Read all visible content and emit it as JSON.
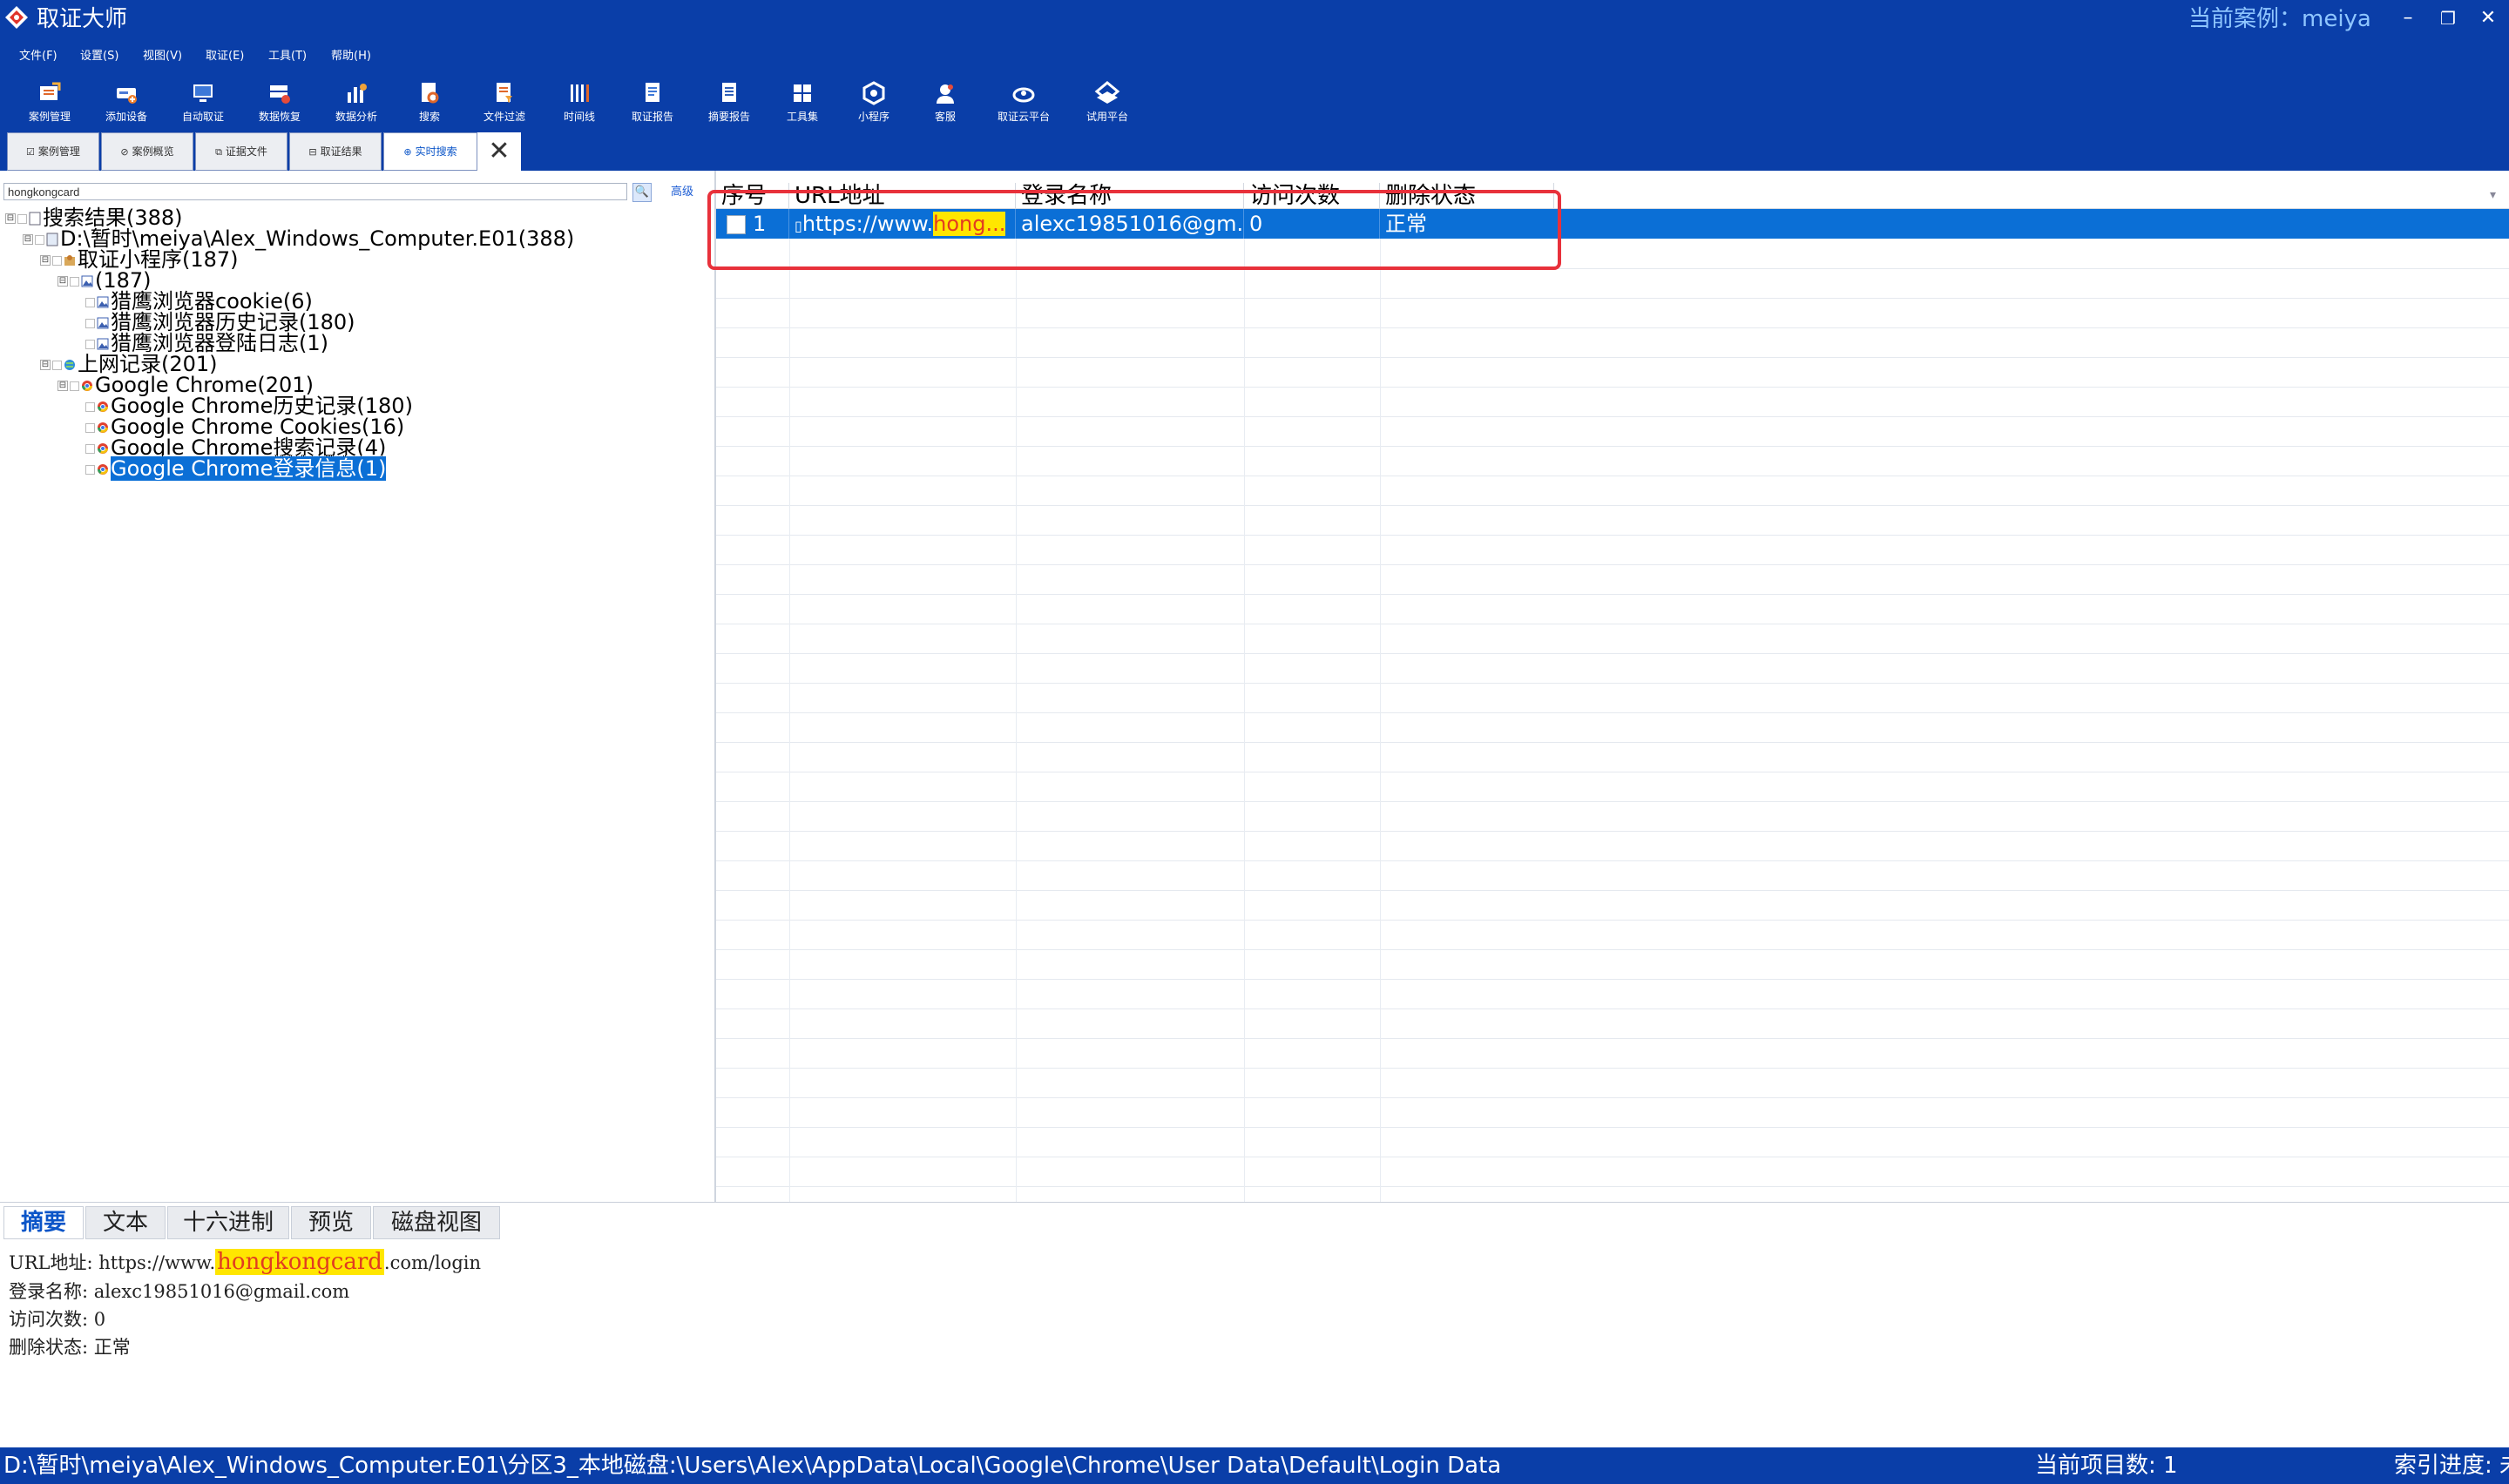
{
  "window": {
    "title": "取证大师",
    "case_label": "当前案例：meiya",
    "buttons": {
      "minimize": "–",
      "restore": "❐",
      "close": "✕"
    }
  },
  "menu": [
    "文件(F)",
    "设置(S)",
    "视图(V)",
    "取证(E)",
    "工具(T)",
    "帮助(H)"
  ],
  "toolbar": [
    {
      "label": "案例管理",
      "icon": "case-manage-icon"
    },
    {
      "label": "添加设备",
      "icon": "add-device-icon"
    },
    {
      "label": "自动取证",
      "icon": "auto-forensic-icon"
    },
    {
      "label": "数据恢复",
      "icon": "data-recovery-icon"
    },
    {
      "label": "数据分析",
      "icon": "data-analysis-icon"
    },
    {
      "label": "搜索",
      "icon": "search-doc-icon"
    },
    {
      "label": "文件过滤",
      "icon": "file-filter-icon"
    },
    {
      "label": "时间线",
      "icon": "timeline-icon"
    },
    {
      "label": "取证报告",
      "icon": "forensic-report-icon"
    },
    {
      "label": "摘要报告",
      "icon": "summary-report-icon"
    },
    {
      "label": "工具集",
      "icon": "toolset-icon"
    },
    {
      "label": "小程序",
      "icon": "applet-icon"
    },
    {
      "label": "客服",
      "icon": "support-icon"
    },
    {
      "label": "取证云平台",
      "icon": "cloud-platform-icon"
    },
    {
      "label": "试用平台",
      "icon": "trial-platform-icon"
    }
  ],
  "tabs": [
    {
      "label": "案例管理",
      "icon": "☑"
    },
    {
      "label": "案例概览",
      "icon": "⊘"
    },
    {
      "label": "证据文件",
      "icon": "⧉"
    },
    {
      "label": "取证结果",
      "icon": "⊟"
    },
    {
      "label": "实时搜索",
      "icon": "⊕",
      "active": true
    }
  ],
  "search": {
    "value": "hongkongcard",
    "button": "🔍",
    "advanced": "高级"
  },
  "tree": [
    {
      "label": "搜索结果(388)",
      "level": 0,
      "toggle": "⊟"
    },
    {
      "label": "D:\\暂时\\meiya\\Alex_Windows_Computer.E01(388)",
      "level": 1,
      "toggle": "⊟"
    },
    {
      "label": "取证小程序(187)",
      "level": 2,
      "toggle": "⊟"
    },
    {
      "label": "(187)",
      "level": 3,
      "toggle": "⊟"
    },
    {
      "label": "猎鹰浏览器cookie(6)",
      "level": 4
    },
    {
      "label": "猎鹰浏览器历史记录(180)",
      "level": 4
    },
    {
      "label": "猎鹰浏览器登陆日志(1)",
      "level": 4
    },
    {
      "label": "上网记录(201)",
      "level": 2,
      "toggle": "⊟"
    },
    {
      "label": "Google Chrome(201)",
      "level": 3,
      "toggle": "⊟"
    },
    {
      "label": "Google Chrome历史记录(180)",
      "level": 4
    },
    {
      "label": "Google Chrome Cookies(16)",
      "level": 4
    },
    {
      "label": "Google Chrome搜索记录(4)",
      "level": 4
    },
    {
      "label": "Google Chrome登录信息(1)",
      "level": 4,
      "selected": true
    }
  ],
  "grid": {
    "columns": [
      "序号",
      "URL地址",
      "登录名称",
      "访问次数",
      "删除状态"
    ],
    "rows": [
      {
        "index": "1",
        "url_prefix": "https://www.",
        "url_highlight": "hong...",
        "login": "alexc19851016@gm...",
        "visits": "0",
        "status": "正常"
      }
    ]
  },
  "bottom_tabs": [
    "摘要",
    "文本",
    "十六进制",
    "预览",
    "磁盘视图"
  ],
  "detail": {
    "url_label": "URL地址:",
    "url_prefix": " https://www.",
    "url_highlight": "hongkongcard",
    "url_suffix": ".com/login",
    "login_line": "登录名称: alexc19851016@gmail.com",
    "visits_line": "访问次数: 0",
    "status_line": "删除状态: 正常"
  },
  "status": {
    "path": "D:\\暂时\\meiya\\Alex_Windows_Computer.E01\\分区3_本地磁盘:\\Users\\Alex\\AppData\\Local\\Google\\Chrome\\User Data\\Default\\Login Data",
    "item_count": "当前项目数: 1",
    "index_progress": "索引进度: 未"
  },
  "colors": {
    "brand": "#0a3ea8",
    "selection": "#0b6fd6",
    "highlight": "#ffe600",
    "annotation": "#e8313b"
  }
}
